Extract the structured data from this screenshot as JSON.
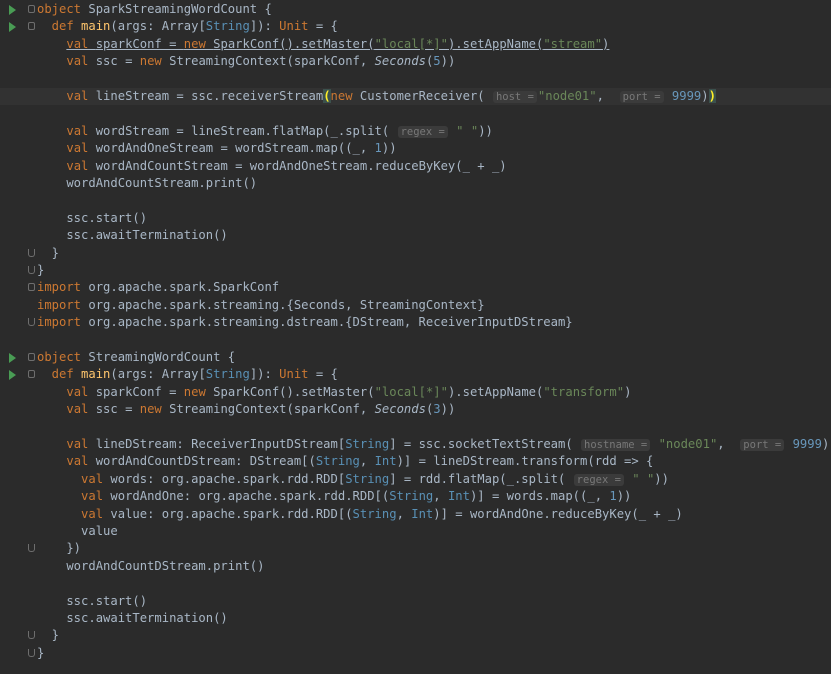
{
  "editor": {
    "colors": {
      "background": "#2b2b2b",
      "keyword": "#cc7832",
      "function": "#ffc66d",
      "type": "#5990b5",
      "string": "#6a8759",
      "number": "#6897bb",
      "text": "#a9b7c6"
    },
    "gutter_icons": [
      "run-icon",
      "fold-icon"
    ],
    "lines": [
      {
        "run": true,
        "fold": "start",
        "tokens": [
          [
            "kw",
            "object "
          ],
          [
            "",
            "SparkStreamingWordCount {"
          ]
        ]
      },
      {
        "run": true,
        "fold": "start",
        "tokens": [
          [
            "kw",
            "  def "
          ],
          [
            "fn",
            "main"
          ],
          [
            "",
            "(args: Array["
          ],
          [
            "ty",
            "String"
          ],
          [
            "",
            "]): "
          ],
          [
            "kw",
            "Unit"
          ],
          [
            "",
            " = {"
          ]
        ]
      },
      {
        "tokens": [
          [
            "",
            "    "
          ],
          [
            "kw|ul",
            "val "
          ],
          [
            "ul",
            "sparkConf = "
          ],
          [
            "kw|ul",
            "new "
          ],
          [
            "ul",
            "SparkConf().setMaster("
          ],
          [
            "st|ul",
            "\"local[*]\""
          ],
          [
            "ul",
            ").setAppName("
          ],
          [
            "st|ul",
            "\"stream\""
          ],
          [
            "ul",
            ")"
          ]
        ]
      },
      {
        "tokens": [
          [
            "",
            "    "
          ],
          [
            "kw",
            "val "
          ],
          [
            "",
            "ssc = "
          ],
          [
            "kw",
            "new "
          ],
          [
            "",
            "StreamingContext(sparkConf, "
          ],
          [
            "it",
            "Seconds"
          ],
          [
            "",
            "("
          ],
          [
            "nu",
            "5"
          ],
          [
            "",
            "))"
          ]
        ]
      },
      {
        "tokens": [
          [
            "",
            ""
          ]
        ]
      },
      {
        "current": true,
        "tokens": [
          [
            "",
            "    "
          ],
          [
            "kw",
            "val "
          ],
          [
            "",
            "lineStream = ssc.receiverStream"
          ],
          [
            "brk",
            "("
          ],
          [
            "kw",
            "new "
          ],
          [
            "",
            "CustomerReceiver( "
          ],
          [
            "hint",
            "host ="
          ],
          [
            " st",
            "\"node01\""
          ],
          [
            "",
            ",  "
          ],
          [
            "hint",
            "port ="
          ],
          [
            "",
            " "
          ],
          [
            "nu",
            "9999"
          ],
          [
            "",
            ")"
          ],
          [
            "brk",
            ")"
          ]
        ]
      },
      {
        "tokens": [
          [
            "",
            ""
          ]
        ]
      },
      {
        "tokens": [
          [
            "",
            "    "
          ],
          [
            "kw",
            "val "
          ],
          [
            "",
            "wordStream = lineStream.flatMap(_.split( "
          ],
          [
            "hint",
            "regex ="
          ],
          [
            "",
            " "
          ],
          [
            "st",
            "\" \""
          ],
          [
            "",
            "))"
          ]
        ]
      },
      {
        "tokens": [
          [
            "",
            "    "
          ],
          [
            "kw",
            "val "
          ],
          [
            "",
            "wordAndOneStream = wordStream.map((_, "
          ],
          [
            "nu",
            "1"
          ],
          [
            "",
            "))"
          ]
        ]
      },
      {
        "tokens": [
          [
            "",
            "    "
          ],
          [
            "kw",
            "val "
          ],
          [
            "",
            "wordAndCountStream = wordAndOneStream.reduceByKey(_ + _)"
          ]
        ]
      },
      {
        "tokens": [
          [
            "",
            "    wordAndCountStream.print()"
          ]
        ]
      },
      {
        "tokens": [
          [
            "",
            ""
          ]
        ]
      },
      {
        "tokens": [
          [
            "",
            "    ssc.start()"
          ]
        ]
      },
      {
        "tokens": [
          [
            "",
            "    ssc.awaitTermination()"
          ]
        ]
      },
      {
        "fold": "end",
        "tokens": [
          [
            "",
            "  }"
          ]
        ]
      },
      {
        "fold": "end",
        "tokens": [
          [
            "",
            "}"
          ]
        ]
      },
      {
        "fold": "start",
        "tokens": [
          [
            "kw",
            "import "
          ],
          [
            "",
            "org.apache.spark.SparkConf"
          ]
        ]
      },
      {
        "tokens": [
          [
            "kw",
            "import "
          ],
          [
            "",
            "org.apache.spark.streaming.{Seconds, StreamingContext}"
          ]
        ]
      },
      {
        "fold": "end",
        "tokens": [
          [
            "kw",
            "import "
          ],
          [
            "",
            "org.apache.spark.streaming.dstream.{DStream, ReceiverInputDStream}"
          ]
        ]
      },
      {
        "tokens": [
          [
            "",
            ""
          ]
        ]
      },
      {
        "run": true,
        "fold": "start",
        "tokens": [
          [
            "kw",
            "object "
          ],
          [
            "",
            "StreamingWordCount {"
          ]
        ]
      },
      {
        "run": true,
        "fold": "start",
        "tokens": [
          [
            "kw",
            "  def "
          ],
          [
            "fn",
            "main"
          ],
          [
            "",
            "(args: Array["
          ],
          [
            "ty",
            "String"
          ],
          [
            "",
            "]): "
          ],
          [
            "kw",
            "Unit"
          ],
          [
            "",
            " = {"
          ]
        ]
      },
      {
        "tokens": [
          [
            "",
            "    "
          ],
          [
            "kw",
            "val "
          ],
          [
            "",
            "sparkConf = "
          ],
          [
            "kw",
            "new "
          ],
          [
            "",
            "SparkConf().setMaster("
          ],
          [
            "st",
            "\"local[*]\""
          ],
          [
            "",
            ").setAppName("
          ],
          [
            "st",
            "\"transform\""
          ],
          [
            "",
            ")"
          ]
        ]
      },
      {
        "tokens": [
          [
            "",
            "    "
          ],
          [
            "kw",
            "val "
          ],
          [
            "",
            "ssc = "
          ],
          [
            "kw",
            "new "
          ],
          [
            "",
            "StreamingContext(sparkConf, "
          ],
          [
            "it",
            "Seconds"
          ],
          [
            "",
            "("
          ],
          [
            "nu",
            "3"
          ],
          [
            "",
            "))"
          ]
        ]
      },
      {
        "tokens": [
          [
            "",
            ""
          ]
        ]
      },
      {
        "tokens": [
          [
            "",
            "    "
          ],
          [
            "kw",
            "val "
          ],
          [
            "",
            "lineDStream: ReceiverInputDStream["
          ],
          [
            "ty",
            "String"
          ],
          [
            "",
            "] = ssc.socketTextStream( "
          ],
          [
            "hint",
            "hostname ="
          ],
          [
            "",
            " "
          ],
          [
            "st",
            "\"node01\""
          ],
          [
            "",
            ",  "
          ],
          [
            "hint",
            "port ="
          ],
          [
            "",
            " "
          ],
          [
            "nu",
            "9999"
          ],
          [
            "",
            ")"
          ]
        ]
      },
      {
        "tokens": [
          [
            "",
            "    "
          ],
          [
            "kw",
            "val "
          ],
          [
            "",
            "wordAndCountDStream: DStream[("
          ],
          [
            "ty",
            "String"
          ],
          [
            "",
            ", "
          ],
          [
            "ty",
            "Int"
          ],
          [
            "",
            ")] = lineDStream.transform(rdd => {"
          ]
        ]
      },
      {
        "tokens": [
          [
            "",
            "      "
          ],
          [
            "kw",
            "val "
          ],
          [
            "",
            "words: org.apache.spark.rdd.RDD["
          ],
          [
            "ty",
            "String"
          ],
          [
            "",
            "] = rdd.flatMap(_.split( "
          ],
          [
            "hint",
            "regex ="
          ],
          [
            "",
            " "
          ],
          [
            "st",
            "\" \""
          ],
          [
            "",
            "))"
          ]
        ]
      },
      {
        "tokens": [
          [
            "",
            "      "
          ],
          [
            "kw",
            "val "
          ],
          [
            "",
            "wordAndOne: org.apache.spark.rdd.RDD[("
          ],
          [
            "ty",
            "String"
          ],
          [
            "",
            ", "
          ],
          [
            "ty",
            "Int"
          ],
          [
            "",
            ")] = words.map((_, "
          ],
          [
            "nu",
            "1"
          ],
          [
            "",
            "))"
          ]
        ]
      },
      {
        "tokens": [
          [
            "",
            "      "
          ],
          [
            "kw",
            "val "
          ],
          [
            "",
            "value: org.apache.spark.rdd.RDD[("
          ],
          [
            "ty",
            "String"
          ],
          [
            "",
            ", "
          ],
          [
            "ty",
            "Int"
          ],
          [
            "",
            ")] = wordAndOne.reduceByKey(_ + _)"
          ]
        ]
      },
      {
        "tokens": [
          [
            "",
            "      value"
          ]
        ]
      },
      {
        "fold": "end",
        "tokens": [
          [
            "",
            "    })"
          ]
        ]
      },
      {
        "tokens": [
          [
            "",
            "    wordAndCountDStream.print()"
          ]
        ]
      },
      {
        "tokens": [
          [
            "",
            ""
          ]
        ]
      },
      {
        "tokens": [
          [
            "",
            "    ssc.start()"
          ]
        ]
      },
      {
        "tokens": [
          [
            "",
            "    ssc.awaitTermination()"
          ]
        ]
      },
      {
        "fold": "end",
        "tokens": [
          [
            "",
            "  }"
          ]
        ]
      },
      {
        "fold": "end",
        "tokens": [
          [
            "",
            "}"
          ]
        ]
      }
    ]
  }
}
